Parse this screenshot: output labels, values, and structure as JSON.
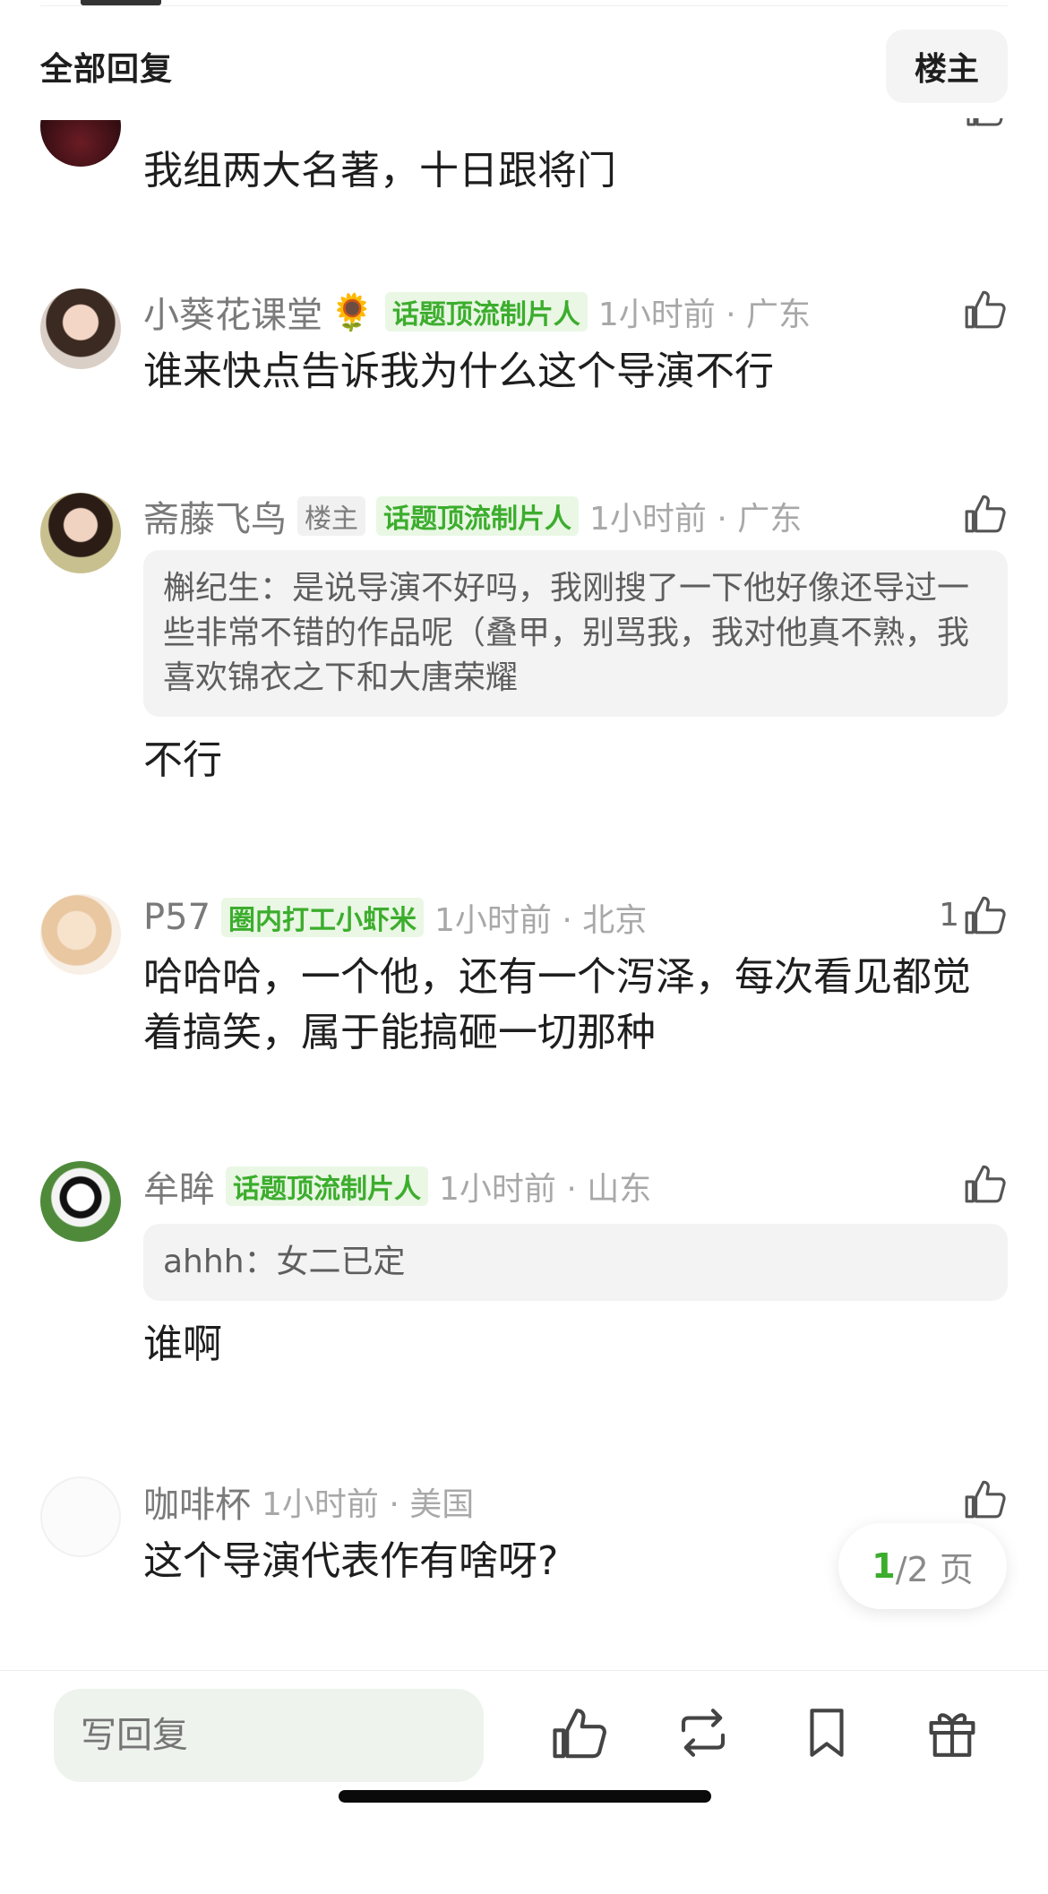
{
  "header": {
    "title": "全部回复",
    "owner_button": "楼主"
  },
  "comments": [
    {
      "username": "小葵花课堂",
      "emoji": "🌻",
      "badge": "话题顶流制片人",
      "time": "1小时前 · 广东",
      "text": "谁来快点告诉我为什么这个导演不行"
    },
    {
      "username": "斋藤飞鸟",
      "owner_badge": "楼主",
      "badge": "话题顶流制片人",
      "time": "1小时前 · 广东",
      "quote": "槲纪生：是说导演不好吗，我刚搜了一下他好像还导过一些非常不错的作品呢（叠甲，别骂我，我对他真不熟，我喜欢锦衣之下和大唐荣耀",
      "text": "不行"
    },
    {
      "username": "P57",
      "badge": "圈内打工小虾米",
      "time": "1小时前 · 北京",
      "like_count": "1",
      "text": "哈哈哈，一个他，还有一个泻泽，每次看见都觉着搞笑，属于能搞砸一切那种"
    },
    {
      "username": "牟眸",
      "badge": "话题顶流制片人",
      "time": "1小时前 · 山东",
      "quote": "ahhh：女二已定",
      "text": "谁啊"
    },
    {
      "username": "咖啡杯",
      "time": "1小时前 · 美国",
      "text": "这个导演代表作有啥呀?"
    }
  ],
  "top_partial_comment": {
    "text": "我组两大名著，十日跟将门"
  },
  "pagination": {
    "current": "1",
    "total": "/2 页"
  },
  "bottom_bar": {
    "reply_placeholder": "写回复"
  },
  "colors": {
    "accent_green": "#3cad2d",
    "badge_bg": "#e9f7e4",
    "quote_bg": "#f3f3f3"
  }
}
